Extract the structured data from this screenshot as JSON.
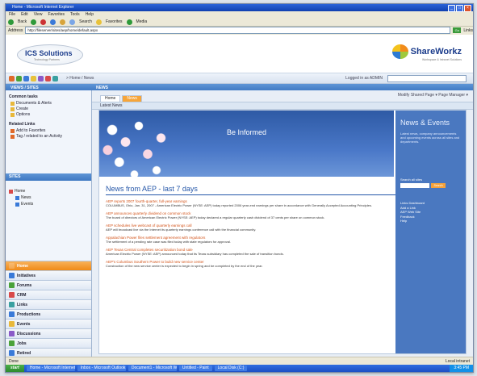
{
  "window": {
    "title": "Home - Microsoft Internet Explorer"
  },
  "menu": [
    "File",
    "Edit",
    "View",
    "Favorites",
    "Tools",
    "Help"
  ],
  "toolbar": {
    "back": "Back",
    "search": "Search",
    "favorites": "Favorites",
    "media": "Media"
  },
  "address": {
    "label": "Address",
    "url": "http://fileserver/sites/aep/home/default.aspx",
    "go": "Go",
    "links": "Links"
  },
  "header": {
    "ics_logo": "ICS Solutions",
    "ics_tag": "Technology Partners",
    "brand": "ShareWorkz",
    "brand_tag": "Workspace & Intranet Solutions"
  },
  "strip": {
    "crumb": "> Home / News",
    "user": "Logged in as ADMIN"
  },
  "bluebar": {
    "left": "VIEWS / SITES",
    "right": "NEWS"
  },
  "left": {
    "groups": [
      {
        "title": "Common tasks",
        "items": [
          "Documents & Alerts",
          "Create",
          "Options"
        ]
      },
      {
        "title": "Related Links",
        "items": [
          "Add to Favorites",
          "Tag / related to an Activity"
        ]
      }
    ],
    "sites_title": "SITES",
    "tree": [
      "Home",
      "News",
      "Events"
    ],
    "nav": [
      "Home",
      "Initiatives",
      "Forums",
      "CRM",
      "Links",
      "Productions",
      "Events",
      "Discussions",
      "Jobs",
      "Retired"
    ]
  },
  "main": {
    "tabs": [
      "Home",
      "News"
    ],
    "tabs_right": "Modify Shared Page ▾ Page Manager ▾",
    "page_title": "Latest News",
    "hero_title": "Be Informed",
    "news_heading": "News from AEP - last 7 days",
    "items": [
      {
        "title": "AEP reports 2007 fourth-quarter, full-year earnings",
        "desc": "COLUMBUS, Ohio, Jan. 31, 2007 - American Electric Power (NYSE: AEP) today reported 2006 year-end earnings per share in accordance with Generally Accepted Accounting Principles."
      },
      {
        "title": "AEP announces quarterly dividend on common stock",
        "desc": "The board of directors of American Electric Power (NYSE: AEP) today declared a regular quarterly cash dividend of 37 cents per share on common stock."
      },
      {
        "title": "AEP schedules live webcast of quarterly earnings call",
        "desc": "AEP will broadcast live via the Internet its quarterly earnings conference call with the financial community."
      },
      {
        "title": "Appalachian Power files settlement agreement with regulators",
        "desc": "The settlement of a pending rate case was filed today with state regulators for approval."
      },
      {
        "title": "AEP Texas Central completes securitization bond sale",
        "desc": "American Electric Power (NYSE: AEP) announced today that its Texas subsidiary has completed the sale of transition bonds."
      },
      {
        "title": "AEP's Columbus Southern Power to build new service center",
        "desc": "Construction of the new service center is expected to begin in spring and be completed by the end of the year."
      }
    ]
  },
  "side": {
    "heading": "News & Events",
    "text": "Latest news, company announcements and upcoming events across all sites and departments.",
    "search_label": "Search all sites",
    "search_button": "Search",
    "links": [
      "Links Dashboard",
      "Add a Link",
      "AEP Web Site",
      "Feedback",
      "Help"
    ]
  },
  "status": {
    "left": "Done",
    "right": "Local intranet"
  },
  "taskbar": {
    "start": "start",
    "tasks": [
      "Home - Microsoft Internet Explorer",
      "Inbox - Microsoft Outlook",
      "Document1 - Microsoft Word",
      "Untitled - Paint",
      "Local Disk (C:)"
    ],
    "clock": "3:45 PM"
  }
}
